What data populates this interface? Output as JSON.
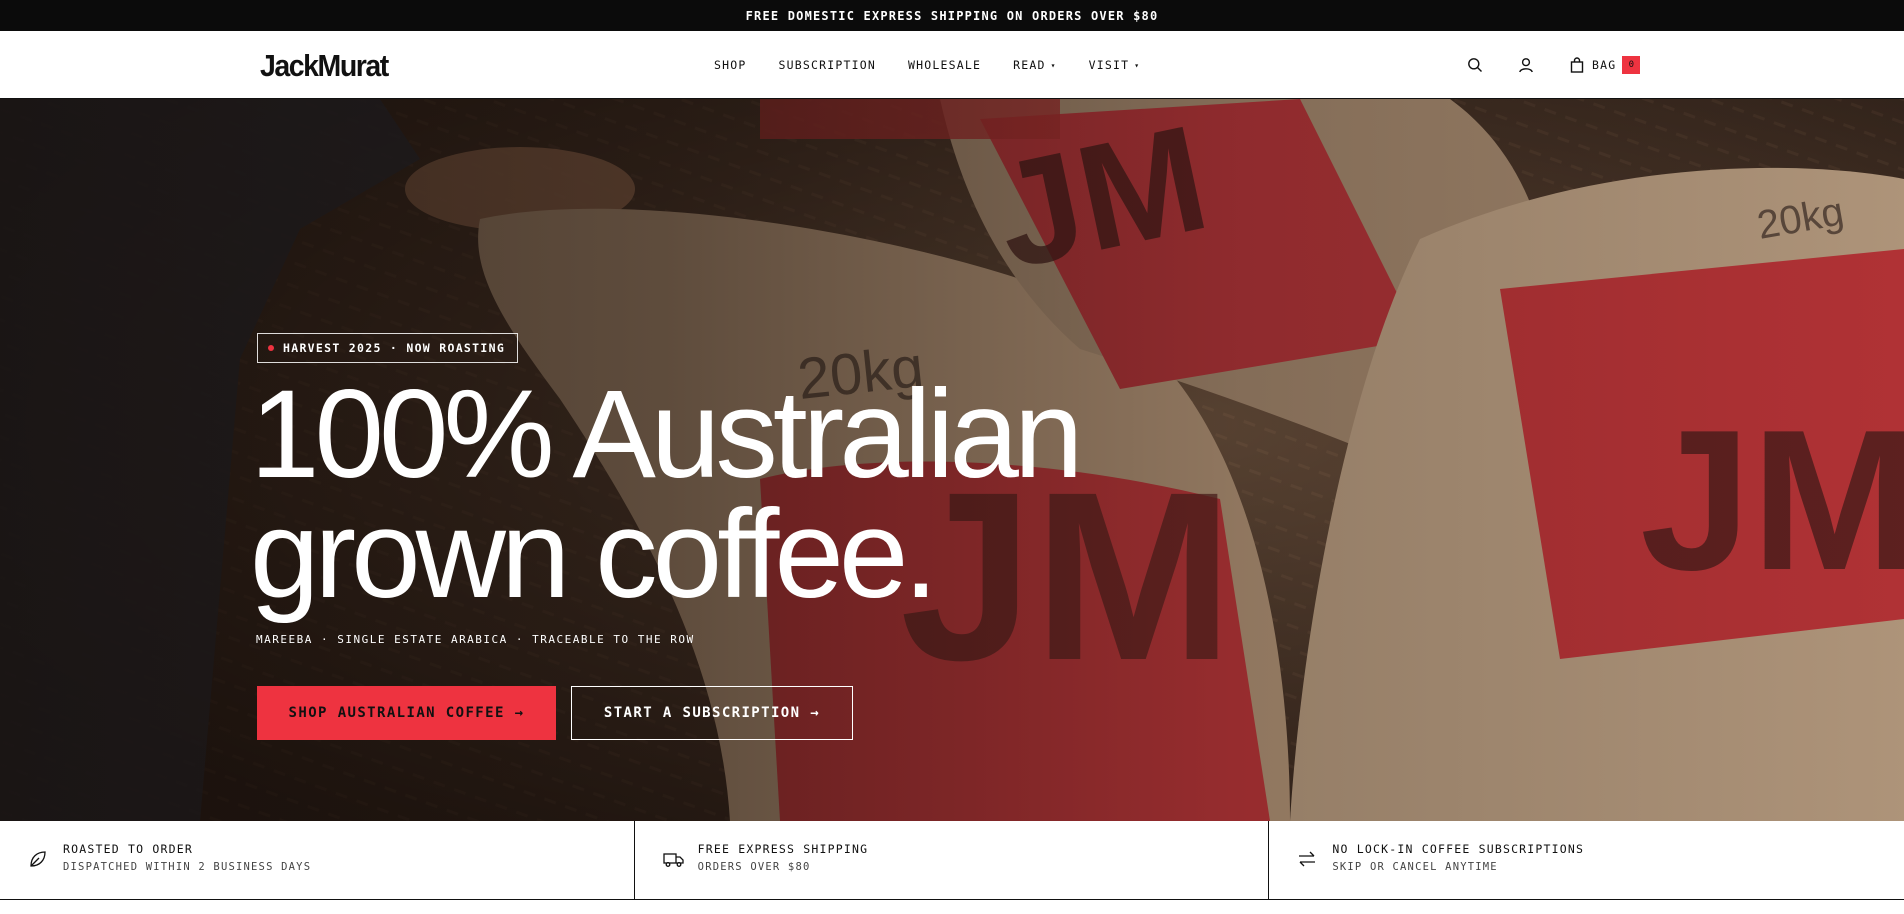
{
  "announcement": {
    "text": "FREE DOMESTIC EXPRESS SHIPPING ON ORDERS OVER $80"
  },
  "header": {
    "logo": "JackMurat",
    "nav": [
      {
        "label": "SHOP",
        "has_dropdown": false
      },
      {
        "label": "SUBSCRIPTION",
        "has_dropdown": false
      },
      {
        "label": "WHOLESALE",
        "has_dropdown": false
      },
      {
        "label": "READ",
        "has_dropdown": true
      },
      {
        "label": "VISIT",
        "has_dropdown": true
      }
    ],
    "icons": {
      "search": "search-icon",
      "account": "user-icon",
      "bag": "bag-icon"
    },
    "bag_label": "BAG",
    "bag_count": "0"
  },
  "hero": {
    "tag": "HARVEST 2025 · NOW ROASTING",
    "headline_line1": "100% Australian",
    "headline_line2": "grown coffee.",
    "subline": "MAREEBA · SINGLE ESTATE ARABICA · TRACEABLE TO THE ROW",
    "primary_cta": "SHOP AUSTRALIAN COFFEE →",
    "secondary_cta": "START A SUBSCRIPTION →"
  },
  "features": [
    {
      "icon": "leaf-icon",
      "title": "ROASTED TO ORDER",
      "subtitle": "DISPATCHED WITHIN 2 BUSINESS DAYS"
    },
    {
      "icon": "truck-icon",
      "title": "FREE EXPRESS SHIPPING",
      "subtitle": "ORDERS OVER $80"
    },
    {
      "icon": "swap-arrows-icon",
      "title": "NO LOCK-IN COFFEE SUBSCRIPTIONS",
      "subtitle": "SKIP OR CANCEL ANYTIME"
    }
  ],
  "colors": {
    "accent": "#ee3340",
    "dark": "#0b0b0b",
    "hero_tint": "#3a2a20"
  }
}
